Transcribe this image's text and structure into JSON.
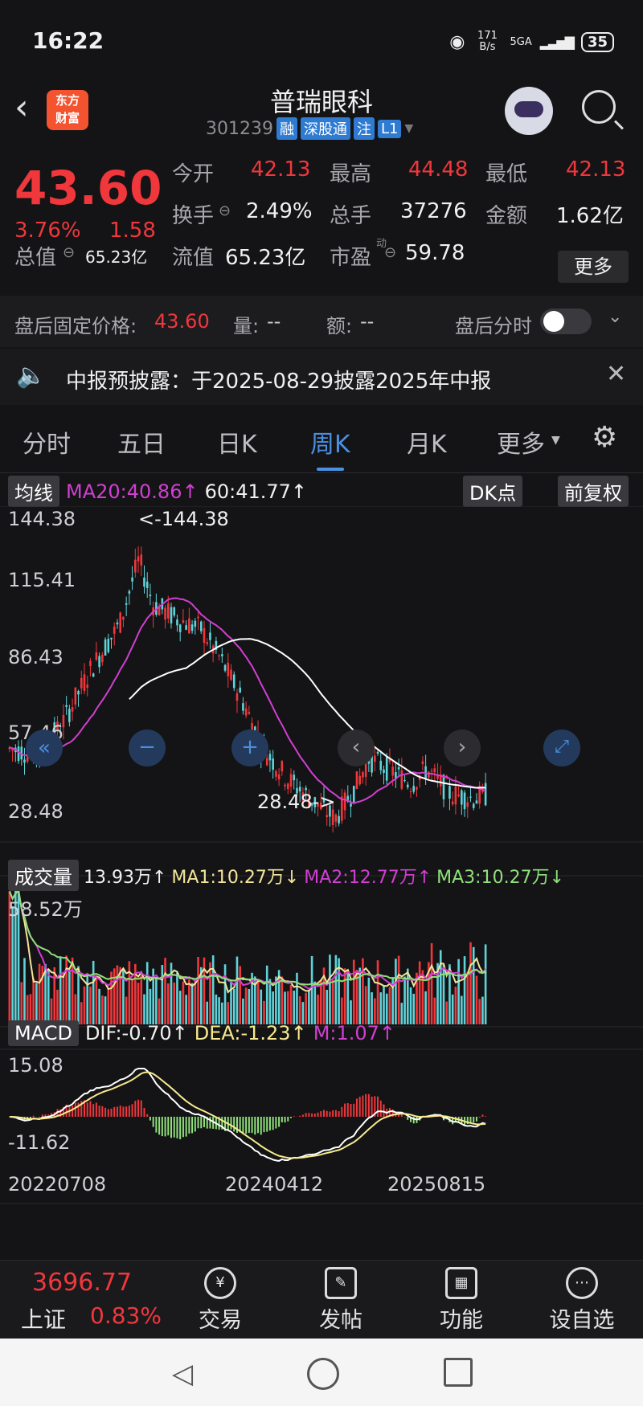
{
  "status_bar": {
    "time": "16:22",
    "speed": "171 B/s",
    "network": "5GA",
    "battery": "35"
  },
  "header": {
    "logo_line1": "东方",
    "logo_line2": "财富",
    "stock_name": "普瑞眼科",
    "code": "301239",
    "tags": [
      "融",
      "深股通",
      "注",
      "L1"
    ]
  },
  "quote": {
    "price": "43.60",
    "change_pct": "3.76%",
    "change_amt": "1.58",
    "fields": [
      {
        "label": "今开",
        "value": "42.13"
      },
      {
        "label": "最高",
        "value": "44.48"
      },
      {
        "label": "最低",
        "value": "42.13"
      },
      {
        "label": "换手",
        "value": "2.49%"
      },
      {
        "label": "总手",
        "value": "37276"
      },
      {
        "label": "金额",
        "value": "1.62亿"
      },
      {
        "label": "总值",
        "value": "65.23亿"
      },
      {
        "label": "流值",
        "value": "65.23亿"
      },
      {
        "label": "市盈",
        "value": "59.78"
      }
    ],
    "pe_sup": "动",
    "more_label": "更多"
  },
  "after_hours": {
    "fixed_price_label": "盘后固定价格:",
    "fixed_price": "43.60",
    "volume_label": "量:",
    "volume": "--",
    "amount_label": "额:",
    "amount": "--",
    "intraday_label": "盘后分时"
  },
  "notice": {
    "text": "中报预披露：于2025-08-29披露2025年中报"
  },
  "tabs": [
    {
      "label": "分时"
    },
    {
      "label": "五日"
    },
    {
      "label": "日K"
    },
    {
      "label": "周K"
    },
    {
      "label": "月K"
    },
    {
      "label": "更多"
    }
  ],
  "active_tab": "周K",
  "kline": {
    "indicator_label": "均线",
    "ma20": "MA20:40.86↑",
    "ma60": "60:41.77↑",
    "dk_label": "DK点",
    "adjust_label": "前复权",
    "y_ticks": [
      "144.38",
      "115.41",
      "86.43",
      "57.46",
      "28.48"
    ],
    "high_marker": "<-144.38",
    "low_marker": "28.48->"
  },
  "volume": {
    "label": "成交量",
    "current": "13.93万↑",
    "ma1": "MA1:10.27万↓",
    "ma2": "MA2:12.77万↑",
    "ma3": "MA3:10.27万↓",
    "max_label": "58.52万"
  },
  "macd": {
    "label": "MACD",
    "dif": "DIF:-0.70↑",
    "dea": "DEA:-1.23↑",
    "m": "M:1.07↑",
    "top": "15.08",
    "bottom": "-11.62"
  },
  "dates": [
    "20220708",
    "20240412",
    "20250815"
  ],
  "bottom_nav": {
    "index_value": "3696.77",
    "index_name": "上证",
    "index_change": "0.83%",
    "items": [
      "交易",
      "发帖",
      "功能",
      "设自选"
    ]
  },
  "colors": {
    "up": "#f0373c",
    "down": "#5fd3d9",
    "accent": "#4a90e2",
    "ma20": "#d13fd1",
    "ma60": "#ffffff"
  }
}
